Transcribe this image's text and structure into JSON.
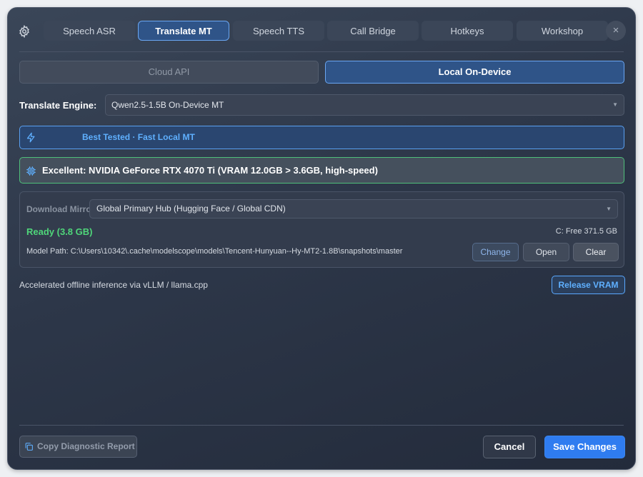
{
  "tabs": [
    {
      "label": "Speech ASR",
      "active": false
    },
    {
      "label": "Translate MT",
      "active": true
    },
    {
      "label": "Speech TTS",
      "active": false
    },
    {
      "label": "Call Bridge",
      "active": false
    },
    {
      "label": "Hotkeys",
      "active": false
    },
    {
      "label": "Workshop",
      "active": false
    }
  ],
  "close_glyph": "×",
  "mode": {
    "cloud": "Cloud API",
    "local": "Local On-Device",
    "selected": "local"
  },
  "engine": {
    "label": "Translate Engine:",
    "value": "Qwen2.5-1.5B On-Device MT"
  },
  "badge": {
    "text": "Best Tested · Fast Local MT"
  },
  "gpu": {
    "text": "Excellent: NVIDIA GeForce RTX 4070 Ti (VRAM 12.0GB > 3.6GB, high-speed)"
  },
  "download": {
    "mirror_label": "Download Mirror",
    "mirror_value": "Global Primary Hub (Hugging Face / Global CDN)",
    "status": "Ready (3.8 GB)",
    "free_space": "C: Free 371.5 GB",
    "path": "Model Path: C:\\Users\\10342\\.cache\\modelscope\\models\\Tencent-Hunyuan--Hy-MT2-1.8B\\snapshots\\master",
    "change": "Change",
    "open": "Open",
    "clear": "Clear"
  },
  "note": "Accelerated offline inference via vLLM / llama.cpp",
  "release_vram": "Release VRAM",
  "footer": {
    "diagnostic": "Copy Diagnostic Report",
    "cancel": "Cancel",
    "save": "Save Changes"
  },
  "colors": {
    "accent": "#2f7cf0",
    "active_tab": "#2f5488",
    "ready": "#4fd67a",
    "highlight": "#5fb0ff"
  }
}
